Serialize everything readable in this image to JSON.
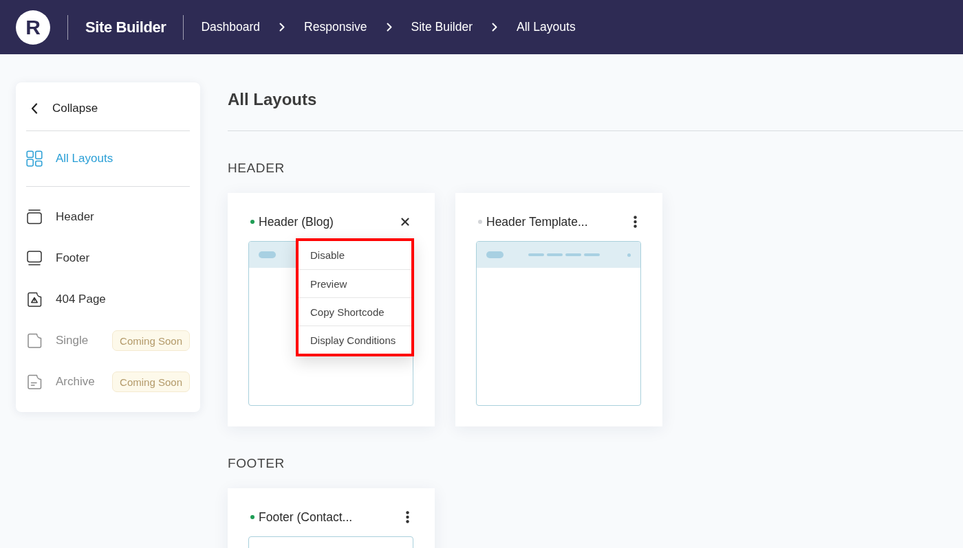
{
  "topbar": {
    "logo": "R",
    "title": "Site Builder",
    "breadcrumbs": [
      "Dashboard",
      "Responsive",
      "Site Builder",
      "All Layouts"
    ]
  },
  "sidebar": {
    "collapse": "Collapse",
    "groups": [
      [
        {
          "label": "All Layouts",
          "selected": true,
          "disabled": false
        }
      ],
      [
        {
          "label": "Header",
          "selected": false,
          "disabled": false
        },
        {
          "label": "Footer",
          "selected": false,
          "disabled": false
        },
        {
          "label": "404 Page",
          "selected": false,
          "disabled": false
        },
        {
          "label": "Single",
          "selected": false,
          "disabled": true,
          "badge": "Coming Soon"
        },
        {
          "label": "Archive",
          "selected": false,
          "disabled": true,
          "badge": "Coming Soon"
        }
      ]
    ]
  },
  "page": {
    "title": "All Layouts"
  },
  "sections": [
    {
      "heading": "HEADER",
      "kind": "header",
      "cards": [
        {
          "title": "Header (Blog)",
          "enabled": true,
          "menu_open": true,
          "menu": [
            "Disable",
            "Preview",
            "Copy Shortcode",
            "Display Conditions"
          ]
        },
        {
          "title": "Header Template...",
          "enabled": false,
          "menu_open": false
        }
      ]
    },
    {
      "heading": "FOOTER",
      "kind": "footer",
      "cards": [
        {
          "title": "Footer (Contact...",
          "enabled": true,
          "menu_open": false
        }
      ]
    }
  ]
}
